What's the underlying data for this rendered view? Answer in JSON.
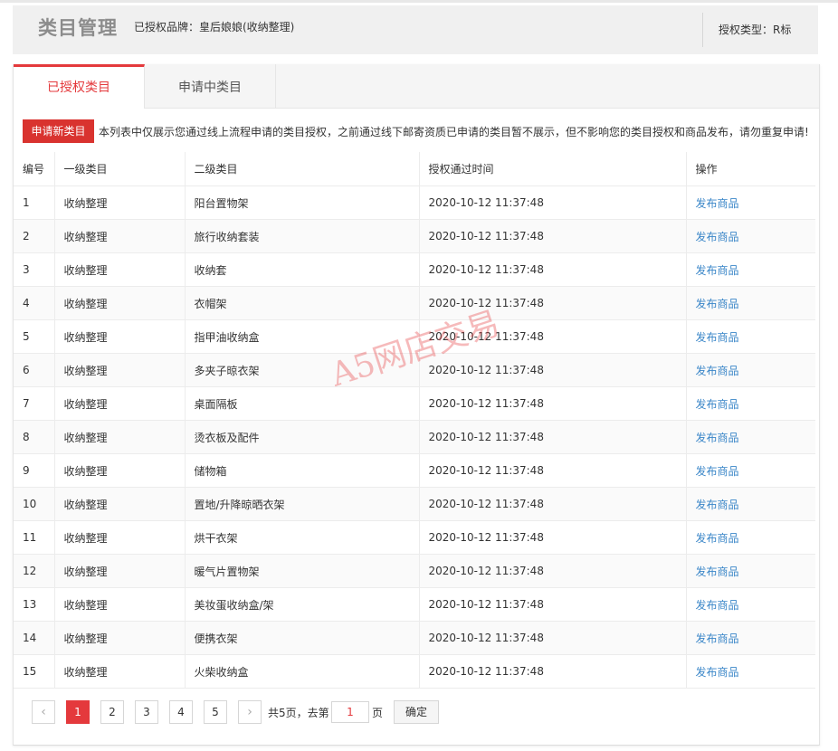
{
  "header": {
    "title": "类目管理",
    "brand_text": "已授权品牌：皇后娘娘(收纳整理)",
    "auth_type": "授权类型：R标"
  },
  "tabs": [
    {
      "label": "已授权类目",
      "active": true
    },
    {
      "label": "申请中类目",
      "active": false
    }
  ],
  "notice": {
    "apply_button": "申请新类目",
    "text": "本列表中仅展示您通过线上流程申请的类目授权，之前通过线下邮寄资质已申请的类目暂不展示，但不影响您的类目授权和商品发布，请勿重复申请!"
  },
  "table": {
    "columns": [
      "编号",
      "一级类目",
      "二级类目",
      "授权通过时间",
      "操作"
    ],
    "rows": [
      {
        "no": "1",
        "level1": "收纳整理",
        "level2": "阳台置物架",
        "time": "2020-10-12 11:37:48",
        "action": "发布商品"
      },
      {
        "no": "2",
        "level1": "收纳整理",
        "level2": "旅行收纳套装",
        "time": "2020-10-12 11:37:48",
        "action": "发布商品"
      },
      {
        "no": "3",
        "level1": "收纳整理",
        "level2": "收纳套",
        "time": "2020-10-12 11:37:48",
        "action": "发布商品"
      },
      {
        "no": "4",
        "level1": "收纳整理",
        "level2": "衣帽架",
        "time": "2020-10-12 11:37:48",
        "action": "发布商品"
      },
      {
        "no": "5",
        "level1": "收纳整理",
        "level2": "指甲油收纳盒",
        "time": "2020-10-12 11:37:48",
        "action": "发布商品"
      },
      {
        "no": "6",
        "level1": "收纳整理",
        "level2": "多夹子晾衣架",
        "time": "2020-10-12 11:37:48",
        "action": "发布商品"
      },
      {
        "no": "7",
        "level1": "收纳整理",
        "level2": "桌面隔板",
        "time": "2020-10-12 11:37:48",
        "action": "发布商品"
      },
      {
        "no": "8",
        "level1": "收纳整理",
        "level2": "烫衣板及配件",
        "time": "2020-10-12 11:37:48",
        "action": "发布商品"
      },
      {
        "no": "9",
        "level1": "收纳整理",
        "level2": "储物箱",
        "time": "2020-10-12 11:37:48",
        "action": "发布商品"
      },
      {
        "no": "10",
        "level1": "收纳整理",
        "level2": "置地/升降晾晒衣架",
        "time": "2020-10-12 11:37:48",
        "action": "发布商品"
      },
      {
        "no": "11",
        "level1": "收纳整理",
        "level2": "烘干衣架",
        "time": "2020-10-12 11:37:48",
        "action": "发布商品"
      },
      {
        "no": "12",
        "level1": "收纳整理",
        "level2": "暖气片置物架",
        "time": "2020-10-12 11:37:48",
        "action": "发布商品"
      },
      {
        "no": "13",
        "level1": "收纳整理",
        "level2": "美妆蛋收纳盒/架",
        "time": "2020-10-12 11:37:48",
        "action": "发布商品"
      },
      {
        "no": "14",
        "level1": "收纳整理",
        "level2": "便携衣架",
        "time": "2020-10-12 11:37:48",
        "action": "发布商品"
      },
      {
        "no": "15",
        "level1": "收纳整理",
        "level2": "火柴收纳盒",
        "time": "2020-10-12 11:37:48",
        "action": "发布商品"
      }
    ]
  },
  "pagination": {
    "prev": "‹",
    "next": "›",
    "pages": [
      "1",
      "2",
      "3",
      "4",
      "5"
    ],
    "current": "1",
    "total_text": "共5页，去第",
    "goto_value": "1",
    "page_suffix": "页",
    "confirm": "确定"
  },
  "watermark": "A5网店交易",
  "colors": {
    "accent": "#e4393c",
    "link": "#3a86c8",
    "apply_button_bg": "#d9332f"
  }
}
